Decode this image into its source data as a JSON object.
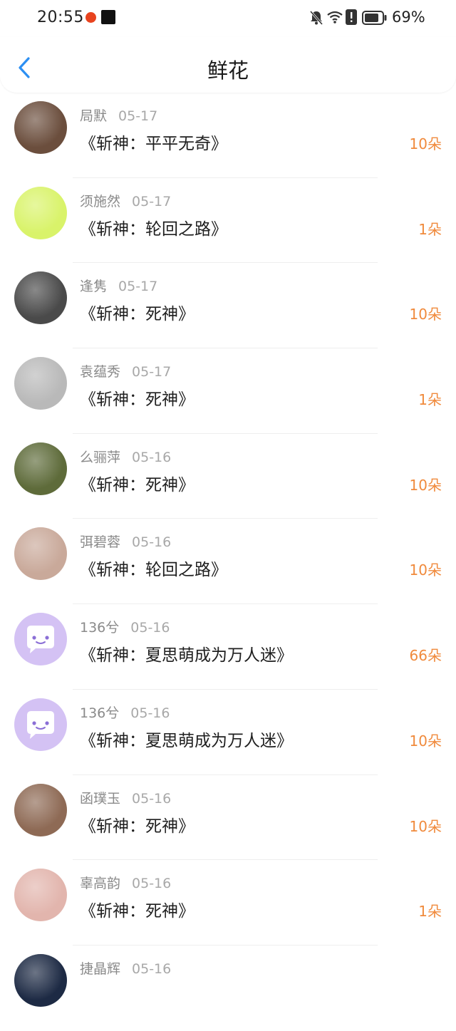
{
  "status": {
    "time": "20:55",
    "battery": "69%",
    "icons": [
      "bell-off-icon",
      "wifi-icon",
      "alert-icon",
      "battery-icon"
    ]
  },
  "header": {
    "title": "鲜花",
    "back_icon": "chevron-left-icon"
  },
  "items": [
    {
      "name": "局默",
      "date": "05-17",
      "book": "《斩神：平平无奇》",
      "flowers": "10朵",
      "avatar_color": "#6b4e3d"
    },
    {
      "name": "须施然",
      "date": "05-17",
      "book": "《斩神：轮回之路》",
      "flowers": "1朵",
      "avatar_color": "#d9f36a"
    },
    {
      "name": "逢隽",
      "date": "05-17",
      "book": "《斩神：死神》",
      "flowers": "10朵",
      "avatar_color": "#4a4a4a"
    },
    {
      "name": "袁蕴秀",
      "date": "05-17",
      "book": "《斩神：死神》",
      "flowers": "1朵",
      "avatar_color": "#b9b9b9"
    },
    {
      "name": "么骊萍",
      "date": "05-16",
      "book": "《斩神：死神》",
      "flowers": "10朵",
      "avatar_color": "#5e6b3a"
    },
    {
      "name": "弭碧蓉",
      "date": "05-16",
      "book": "《斩神：轮回之路》",
      "flowers": "10朵",
      "avatar_color": "#c9a99a"
    },
    {
      "name": "136兮",
      "date": "05-16",
      "book": "《斩神：夏思萌成为万人迷》",
      "flowers": "66朵",
      "avatar_color": "#d4c2f4"
    },
    {
      "name": "136兮",
      "date": "05-16",
      "book": "《斩神：夏思萌成为万人迷》",
      "flowers": "10朵",
      "avatar_color": "#d4c2f4"
    },
    {
      "name": "函璞玉",
      "date": "05-16",
      "book": "《斩神：死神》",
      "flowers": "10朵",
      "avatar_color": "#8e6a55"
    },
    {
      "name": "辜高韵",
      "date": "05-16",
      "book": "《斩神：死神》",
      "flowers": "1朵",
      "avatar_color": "#e2b5ad"
    },
    {
      "name": "捷晶辉",
      "date": "05-16",
      "book": "",
      "flowers": "",
      "avatar_color": "#1d2a44"
    }
  ]
}
